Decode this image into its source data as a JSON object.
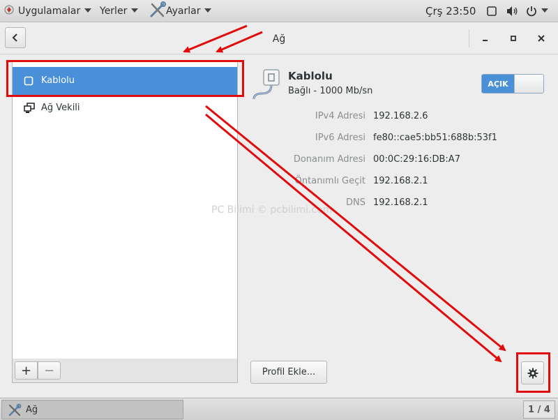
{
  "topbar": {
    "apps_label": "Uygulamalar",
    "places_label": "Yerler",
    "settings_label": "Ayarlar",
    "clock": "Çrş 23:50"
  },
  "header": {
    "title": "Ağ"
  },
  "sidebar": {
    "items": [
      {
        "label": "Kablolu",
        "icon": "wired-connection-icon",
        "selected": true
      },
      {
        "label": "Ağ Vekili",
        "icon": "network-proxy-icon",
        "selected": false
      }
    ],
    "add_label": "+",
    "remove_label": "−"
  },
  "detail": {
    "name": "Kablolu",
    "status": "Bağlı - 1000 Mb/sn",
    "toggle_label": "AÇIK",
    "fields": [
      {
        "label": "IPv4 Adresi",
        "value": "192.168.2.6"
      },
      {
        "label": "IPv6 Adresi",
        "value": "fe80::cae5:bb51:688b:53f1"
      },
      {
        "label": "Donanım Adresi",
        "value": "00:0C:29:16:DB:A7"
      },
      {
        "label": "Öntanımlı Geçit",
        "value": "192.168.2.1"
      },
      {
        "label": "DNS",
        "value": "192.168.2.1"
      }
    ],
    "add_profile_label": "Profil Ekle...",
    "watermark": "PC Bilimi © pcbilimi.com"
  },
  "taskbar": {
    "window_label": "Ağ",
    "workspace": "1 / 4"
  },
  "colors": {
    "accent": "#4a90d9",
    "annotation": "#e10b0b"
  }
}
